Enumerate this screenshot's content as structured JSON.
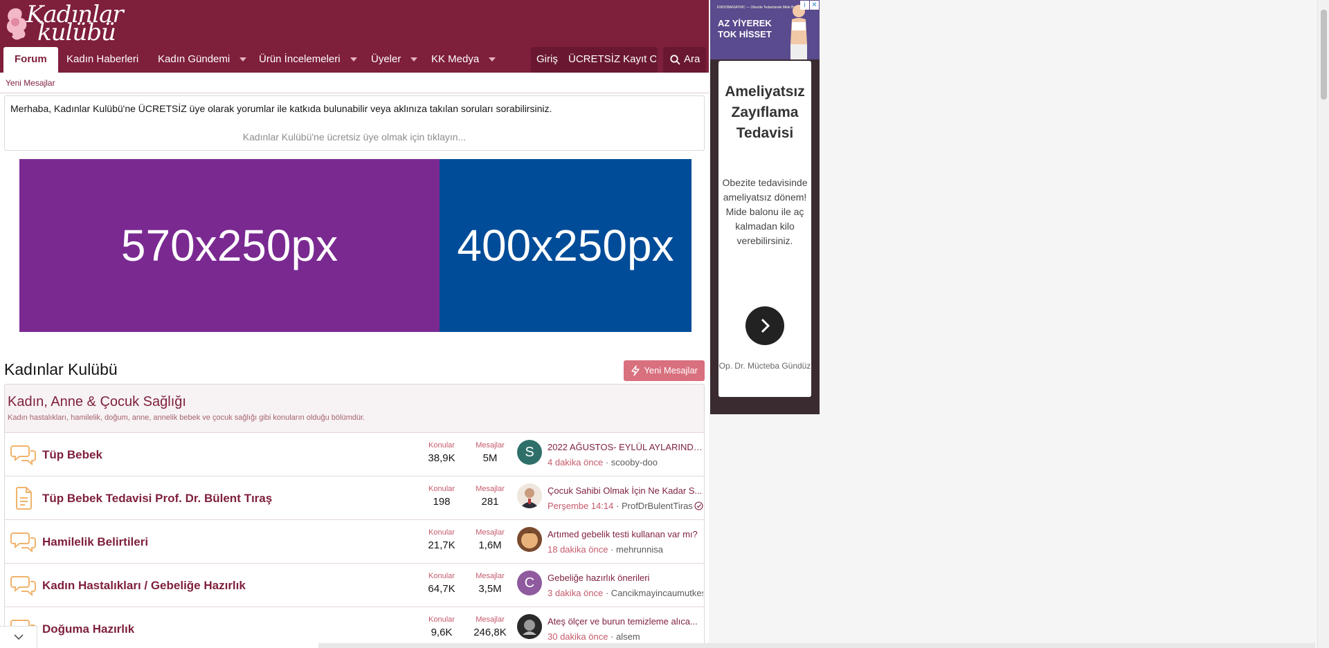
{
  "site": {
    "logo_line1": "Kadınlar",
    "logo_line2": "kulübü"
  },
  "nav": {
    "items": [
      "Forum",
      "Kadın Haberleri",
      "Kadın Gündemi",
      "Ürün İncelemeleri",
      "Üyeler",
      "KK Medya"
    ],
    "login": "Giriş",
    "register": "ÜCRETSİZ Kayıt Ol",
    "search": "Ara"
  },
  "subnav": {
    "new_posts": "Yeni Mesajlar"
  },
  "notice": {
    "message": "Merhaba, Kadınlar Kulübü'ne ÜCRETSİZ üye olarak yorumlar ile katkıda bulunabilir veya aklınıza takılan soruları sorabilirsiniz.",
    "cta": "Kadınlar Kulübü'ne ücretsiz üye olmak için tıklayın..."
  },
  "banners": {
    "left": "570x250px",
    "right": "400x250px",
    "left_color": "#7a2991",
    "right_color": "#004c99"
  },
  "page": {
    "title": "Kadınlar Kulübü",
    "new_posts_button": "Yeni Mesajlar"
  },
  "category": {
    "title": "Kadın, Anne & Çocuk Sağlığı",
    "description": "Kadın hastalıkları, hamilelik, doğum, anne, annelik bebek ve çocuk sağlığı gibi konuların olduğu bölümdür."
  },
  "labels": {
    "threads": "Konular",
    "posts": "Mesajlar"
  },
  "forums": [
    {
      "name": "Tüp Bebek",
      "threads": "38,9K",
      "posts": "5M",
      "last_title": "2022 AĞUSTOS- EYLÜL AYLARINDA ...",
      "last_time": "4 dakika önce",
      "last_user": "scooby-doo",
      "avatar_letter": "S",
      "avatar_color": "#2f6f6a",
      "icon": "chat-bubbles-icon"
    },
    {
      "name": "Tüp Bebek Tedavisi Prof. Dr. Bülent Tıraş",
      "threads": "198",
      "posts": "281",
      "last_title": "Çocuk Sahibi Olmak İçin Ne Kadar S...",
      "last_time": "Perşembe 14:14",
      "last_user": "ProfDrBulentTiras",
      "avatar_letter": "",
      "avatar_color": "#d9c7b8",
      "icon": "document-icon"
    },
    {
      "name": "Hamilelik Belirtileri",
      "threads": "21,7K",
      "posts": "1,6M",
      "last_title": "Artımed gebelik testi kullanan var mı?",
      "last_time": "18 dakika önce",
      "last_user": "mehrunnisa",
      "avatar_letter": "",
      "avatar_color": "#d99a5b",
      "icon": "chat-bubbles-icon"
    },
    {
      "name": "Kadın Hastalıkları / Gebeliğe Hazırlık",
      "threads": "64,7K",
      "posts": "3,5M",
      "last_title": "Gebeliğe hazırlık önerileri",
      "last_time": "3 dakika önce",
      "last_user": "Cancikmayincaumutkes",
      "avatar_letter": "C",
      "avatar_color": "#8f5a9e",
      "icon": "chat-bubbles-icon"
    },
    {
      "name": "Doğuma Hazırlık",
      "threads": "9,6K",
      "posts": "246,8K",
      "last_title": "Ateş ölçer ve burun temizleme alıca...",
      "last_time": "30 dakika önce",
      "last_user": "alsem",
      "avatar_letter": "",
      "avatar_color": "#444444",
      "icon": "chat-bubbles-icon"
    }
  ],
  "ad": {
    "top_small": "ENDOBARIATRIC — Obezite Tedavisinde Mide Balonu ile",
    "top_line1": "AZ YİYEREK",
    "top_line2": "TOK HİSSET",
    "headline": "Ameliyatsız Zayıflama Tedavisi",
    "body": "Obezite tedavisinde ameliyatsız dönem! Mide balonu ile aç kalmadan kilo verebilirsiniz.",
    "byline": "Op. Dr. Mücteba Gündüz"
  },
  "colors": {
    "brand": "#7e1f3b",
    "accent": "#d9707e"
  }
}
